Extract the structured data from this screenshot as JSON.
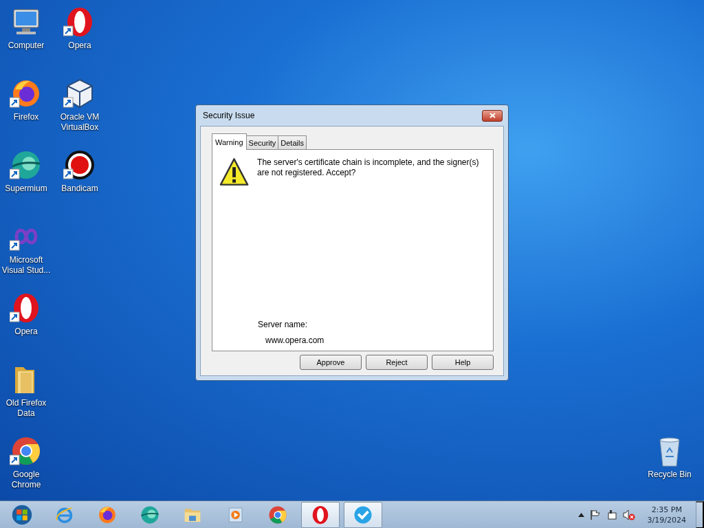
{
  "desktop_icons": [
    {
      "kind": "computer",
      "label": "Computer",
      "shortcut": false
    },
    {
      "kind": "opera",
      "label": "Opera",
      "shortcut": true
    },
    {
      "kind": "firefox",
      "label": "Firefox",
      "shortcut": true
    },
    {
      "kind": "virtualbox",
      "label": "Oracle VM VirtualBox",
      "shortcut": true
    },
    {
      "kind": "supermium",
      "label": "Supermium",
      "shortcut": true
    },
    {
      "kind": "bandicam",
      "label": "Bandicam",
      "shortcut": true
    },
    {
      "kind": "visualstudio",
      "label": "Microsoft Visual Stud...",
      "shortcut": true
    },
    {
      "kind": "opera",
      "label": "Opera",
      "shortcut": true
    },
    {
      "kind": "folder",
      "label": "Old Firefox Data",
      "shortcut": false
    },
    {
      "kind": "chrome",
      "label": "Google Chrome",
      "shortcut": true
    },
    {
      "kind": "recycle",
      "label": "Recycle Bin",
      "shortcut": false
    }
  ],
  "dialog": {
    "title": "Security Issue",
    "tabs": [
      {
        "label": "Warning",
        "selected": true
      },
      {
        "label": "Security",
        "selected": false
      },
      {
        "label": "Details",
        "selected": false
      }
    ],
    "message": "The server's certificate chain is incomplete, and the signer(s) are not registered. Accept?",
    "server_label": "Server name:",
    "server_value": "www.opera.com",
    "buttons": [
      "Approve",
      "Reject",
      "Help"
    ]
  },
  "taskbar": {
    "items": [
      {
        "kind": "start",
        "active": false
      },
      {
        "kind": "ie",
        "active": false
      },
      {
        "kind": "firefox",
        "active": false
      },
      {
        "kind": "supermium",
        "active": false
      },
      {
        "kind": "explorer",
        "active": false
      },
      {
        "kind": "media",
        "active": false
      },
      {
        "kind": "chrome",
        "active": false
      },
      {
        "kind": "opera",
        "active": true
      },
      {
        "kind": "app",
        "active": true
      }
    ],
    "tray": {
      "time": "2:35 PM",
      "date": "3/19/2024",
      "muted": true
    }
  }
}
